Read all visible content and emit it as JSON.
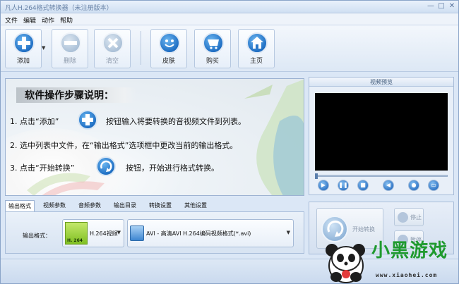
{
  "window": {
    "title": "凡人H.264格式转换器（未注册版本）",
    "controls": [
      "—",
      "□",
      "✕"
    ]
  },
  "menu": [
    "文件",
    "编辑",
    "动作",
    "帮助"
  ],
  "toolbar": {
    "add": "添加",
    "delete": "删除",
    "clear": "清空",
    "skin": "皮肤",
    "buy": "购买",
    "home": "主页"
  },
  "instructions": {
    "heading": "软件操作步骤说明：",
    "step1_pre": "1. 点击“添加”",
    "step1_post": "按钮输入将要转换的音视频文件到列表。",
    "step2": "2. 选中列表中文件，在“输出格式”选项框中更改当前的输出格式。",
    "step3_pre": "3. 点击“开始转换”",
    "step3_post": "按钮，开始进行格式转换。"
  },
  "preview": {
    "title": "视频预览",
    "seek_progress": 0
  },
  "tabs": [
    "输出格式",
    "视频参数",
    "音频参数",
    "输出目录",
    "转换设置",
    "其他设置"
  ],
  "active_tab": 0,
  "output": {
    "label": "输出格式：",
    "format_category": "H.264视频",
    "format_badge": "H. 264",
    "format_detail": "AVI - 高清AVI H.264编码视频格式(*.avi)"
  },
  "actions": {
    "start": "开始转换",
    "stop": "停止",
    "pause": "暂停"
  },
  "watermark": {
    "brand": "小黑游戏",
    "url": "www.xiaohei.com"
  },
  "colors": {
    "accent": "#1f6fc4",
    "video_bg": "#000000",
    "watermark_green": "#1f9a2e"
  }
}
